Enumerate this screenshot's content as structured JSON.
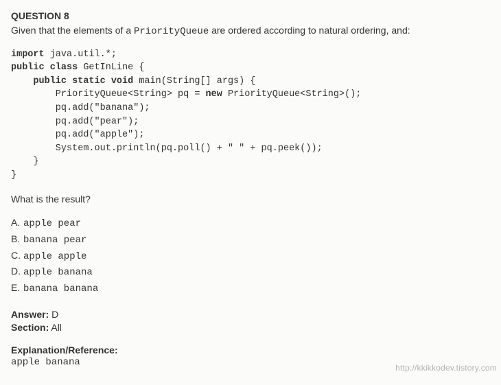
{
  "question": {
    "heading": "QUESTION 8",
    "intro_pre": "Given that the elements of a ",
    "intro_code": "PriorityQueue",
    "intro_post": " are ordered according to natural ordering, and:"
  },
  "code": {
    "l1_kw": "import",
    "l1_rest": " java.util.*;",
    "l2_kw": "public class",
    "l2_rest": " GetInLine {",
    "l3_indent": "    ",
    "l3_kw": "public static void",
    "l3_rest": " main(String[] args) {",
    "l4": "        PriorityQueue<String> pq = ",
    "l4_kw": "new",
    "l4_rest": " PriorityQueue<String>();",
    "l5": "        pq.add(\"banana\");",
    "l6": "        pq.add(\"pear\");",
    "l7": "        pq.add(\"apple\");",
    "l8": "        System.out.println(pq.poll() + \" \" + pq.peek());",
    "l9": "    }",
    "l10": "}"
  },
  "prompt_result": "What is the result?",
  "choices": [
    {
      "letter": "A.",
      "text": "apple pear"
    },
    {
      "letter": "B.",
      "text": "banana pear"
    },
    {
      "letter": "C.",
      "text": "apple apple"
    },
    {
      "letter": "D.",
      "text": "apple banana"
    },
    {
      "letter": "E.",
      "text": "banana banana"
    }
  ],
  "answer": {
    "label": "Answer:",
    "value": "D",
    "section_label": "Section:",
    "section_value": "All"
  },
  "explanation": {
    "label": "Explanation/Reference:",
    "text": "apple banana"
  },
  "watermark": "http://kkikkodev.tistory.com"
}
